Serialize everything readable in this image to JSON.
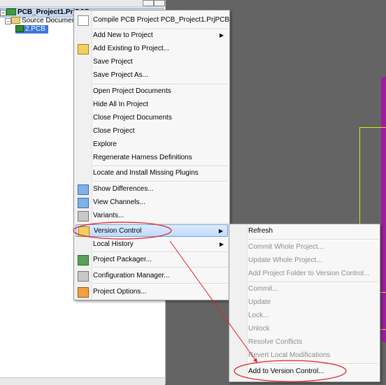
{
  "tree": {
    "project": "PCB_Project1.PrjPCB",
    "source_folder": "Source Documents",
    "pcb_file": "2.PCB"
  },
  "context_menu": {
    "items": [
      {
        "label": "Compile PCB Project PCB_Project1.PrjPCB",
        "icon": "compile-icon"
      },
      {
        "label": "Add New to Project",
        "submenu": true
      },
      {
        "label": "Add Existing to Project...",
        "icon": "add-existing-icon"
      },
      {
        "label": "Save Project"
      },
      {
        "label": "Save Project As..."
      },
      {
        "label": "Open Project Documents"
      },
      {
        "label": "Hide All In Project"
      },
      {
        "label": "Close Project Documents"
      },
      {
        "label": "Close Project"
      },
      {
        "label": "Explore"
      },
      {
        "label": "Regenerate Harness Definitions"
      },
      {
        "label": "Locate and Install Missing Plugins"
      },
      {
        "label": "Show Differences...",
        "icon": "differences-icon"
      },
      {
        "label": "View Channels...",
        "icon": "channels-icon"
      },
      {
        "label": "Variants...",
        "icon": "variants-icon"
      },
      {
        "label": "Version Control",
        "icon": "version-control-icon",
        "submenu": true,
        "highlighted": true
      },
      {
        "label": "Local History",
        "submenu": true
      },
      {
        "label": "Project Packager...",
        "icon": "packager-icon"
      },
      {
        "label": "Configuration Manager...",
        "icon": "configuration-icon"
      },
      {
        "label": "Project Options...",
        "icon": "options-icon"
      }
    ]
  },
  "version_control_submenu": {
    "items": [
      {
        "label": "Refresh",
        "enabled": true
      },
      {
        "label": "Commit Whole Project...",
        "enabled": false
      },
      {
        "label": "Update Whole Project...",
        "enabled": false
      },
      {
        "label": "Add Project Folder to Version Control...",
        "enabled": false
      },
      {
        "label": "Commit...",
        "enabled": false
      },
      {
        "label": "Update",
        "enabled": false
      },
      {
        "label": "Lock...",
        "enabled": false
      },
      {
        "label": "Unlock",
        "enabled": false
      },
      {
        "label": "Resolve Conflicts",
        "enabled": false
      },
      {
        "label": "Revert Local Modifications",
        "enabled": false
      },
      {
        "label": "Add to Version Control...",
        "enabled": true
      }
    ]
  },
  "colors": {
    "annotation": "#e0202a",
    "highlight": "#c1dbfc",
    "board_outline": "#e7e700",
    "canvas": "#646464"
  }
}
